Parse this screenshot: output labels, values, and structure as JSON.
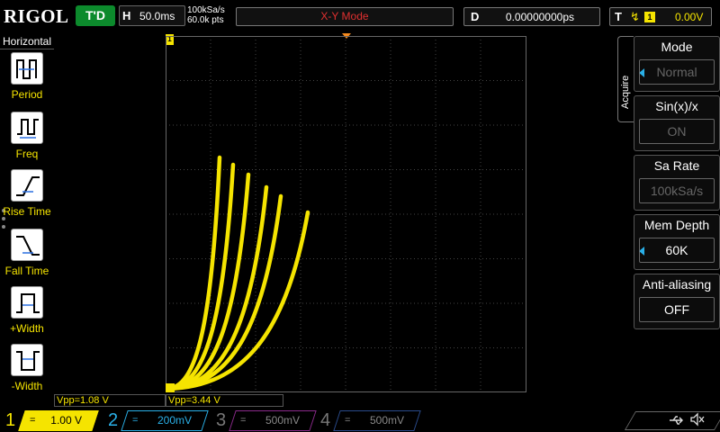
{
  "header": {
    "logo": "RIGOL",
    "trig_status": "T'D",
    "horizontal_label": "H",
    "timebase": "50.0ms",
    "sample_rate": "100kSa/s",
    "mem_points": "60.0k pts",
    "mode_label": "X-Y Mode",
    "delay_label": "D",
    "delay_value": "0.00000000ps",
    "trigger_label": "T",
    "trigger_source": "1",
    "trigger_level": "0.00V"
  },
  "measure_panel": {
    "title": "Horizontal",
    "items": [
      {
        "label": "Period",
        "icon": "period-icon"
      },
      {
        "label": "Freq",
        "icon": "freq-icon"
      },
      {
        "label": "Rise Time",
        "icon": "rise-time-icon"
      },
      {
        "label": "Fall Time",
        "icon": "fall-time-icon"
      },
      {
        "label": "+Width",
        "icon": "pos-width-icon"
      },
      {
        "label": "-Width",
        "icon": "neg-width-icon"
      }
    ]
  },
  "measurements": {
    "vpp_ch1": "Vpp=1.08 V",
    "vpp_ch2": "Vpp=3.44 V"
  },
  "menu": {
    "tab": "Acquire",
    "items": [
      {
        "title": "Mode",
        "value": "Normal"
      },
      {
        "title": "Sin(x)/x",
        "value": "ON"
      },
      {
        "title": "Sa Rate",
        "value": "100kSa/s"
      },
      {
        "title": "Mem Depth",
        "value": "60K"
      },
      {
        "title": "Anti-aliasing",
        "value": "OFF"
      }
    ]
  },
  "channels": [
    {
      "num": "1",
      "scale": "1.00 V",
      "color": "#f5e400",
      "active": true
    },
    {
      "num": "2",
      "scale": "200mV",
      "color": "#2ab0e8",
      "active": false
    },
    {
      "num": "3",
      "scale": "500mV",
      "color": "#e040e0",
      "active": false
    },
    {
      "num": "4",
      "scale": "500mV",
      "color": "#3d6fd8",
      "active": false
    }
  ],
  "colors": {
    "trace": "#f5e400",
    "mode_text": "#e03030",
    "trig_badge": "#0c8a2c",
    "trigger_marker": "#f58a1e"
  }
}
